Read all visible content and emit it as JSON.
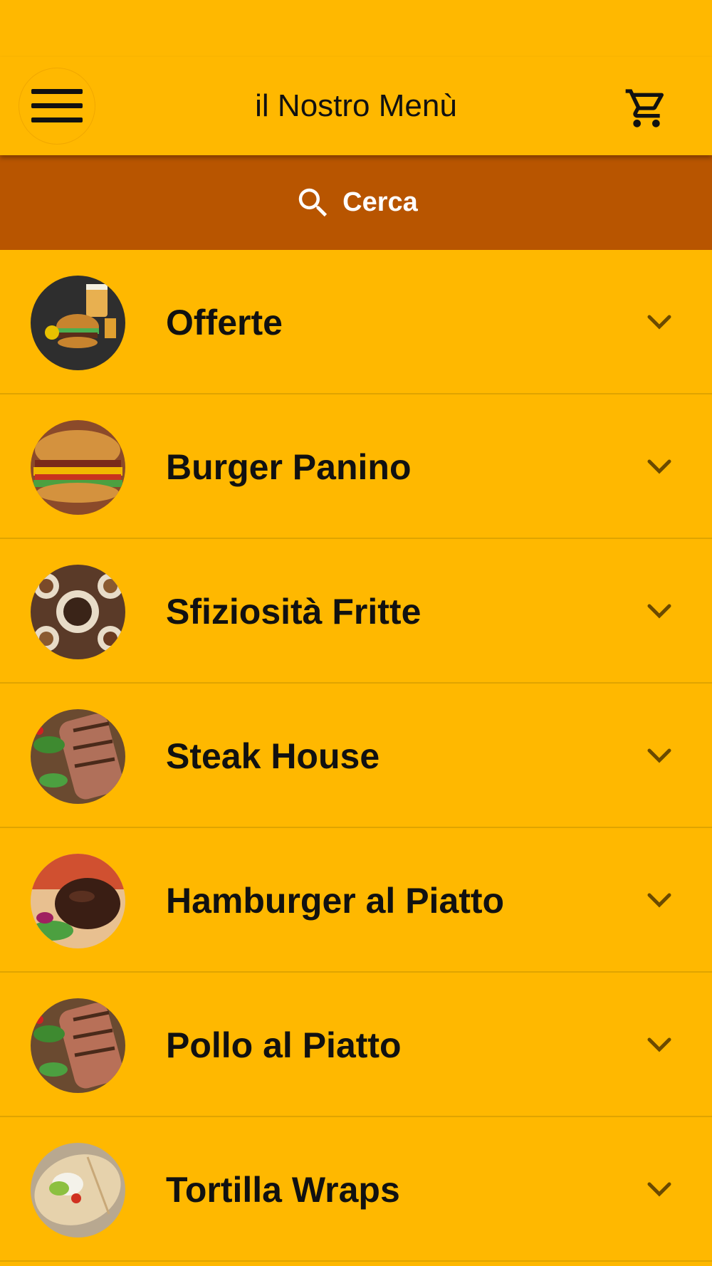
{
  "header": {
    "title": "il Nostro Menù",
    "menu_icon": "hamburger-menu-icon",
    "cart_icon": "shopping-cart-icon"
  },
  "search": {
    "label": "Cerca",
    "icon": "search-icon"
  },
  "colors": {
    "background": "#FFB800",
    "search_bar": "#B85500",
    "chevron": "#6B4A00",
    "divider": "#E0A400"
  },
  "categories": [
    {
      "label": "Offerte",
      "image": "burger-beer-photo"
    },
    {
      "label": "Burger Panino",
      "image": "bacon-burger-photo"
    },
    {
      "label": "Sfiziosità Fritte",
      "image": "fried-snacks-photo"
    },
    {
      "label": "Steak House",
      "image": "grilled-steak-photo"
    },
    {
      "label": "Hamburger al Piatto",
      "image": "hamburger-plate-photo"
    },
    {
      "label": "Pollo al Piatto",
      "image": "grilled-chicken-photo"
    },
    {
      "label": "Tortilla Wraps",
      "image": "tortilla-wrap-photo"
    }
  ]
}
